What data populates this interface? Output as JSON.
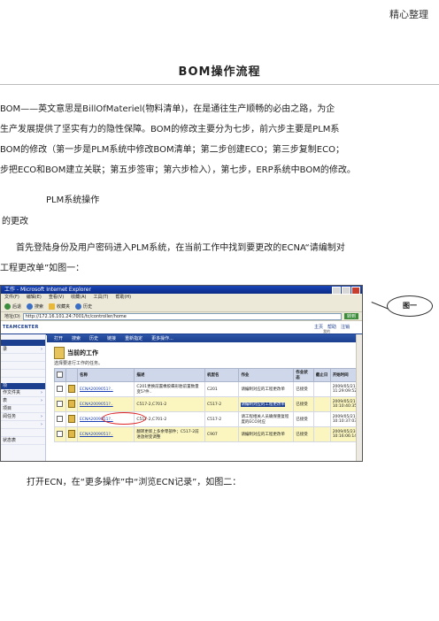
{
  "header": {
    "tag": "精心整理"
  },
  "doc": {
    "title": "BOM操作流程",
    "paragraphs": [
      "BOM——英文意思是BillOfMateriel(物料清单)，在是通往生产顺畅的必由之路，为企",
      "生产发展提供了坚实有力的隐性保障。BOM的修改主要分为七步，前六步主要是PLM系",
      "BOM的修改（第一步是PLM系统中修改BOM清单；第二步创建ECO；第三步复制ECO；",
      "步把ECO和BOM建立关联；第五步签审；第六步检入），第七步，ERP系统中BOM的修改。",
      "PLM系统操作",
      "的更改",
      "首先登陆身份及用户密码进入PLM系统，在当前工作中找到要更改的ECNA“请编制对",
      "工程更改单”如图一："
    ],
    "caption": "打开ECN，在“更多操作”中“浏览ECN记录”，如图二：",
    "callout": "图一"
  },
  "screenshot": {
    "window_title": "工作 - Microsoft Internet Explorer",
    "menu": [
      "文件(F)",
      "编辑(E)",
      "查看(V)",
      "收藏(A)",
      "工具(T)",
      "帮助(H)"
    ],
    "toolbar": [
      "后退",
      "搜索",
      "收藏夹",
      "历史"
    ],
    "address_label": "地址(D)",
    "address": "http://172.16.101.24:7001/tc/controller/home",
    "go": "转到",
    "brand": "TEAMCENTER",
    "user_links": [
      "主页",
      "帮助",
      "注销"
    ],
    "user_sub": "我的",
    "sidebar": {
      "heads": [
        "",
        "项"
      ],
      "items": [
        "录",
        "",
        "",
        "",
        "作文件夹",
        "表",
        "项目",
        "阅任务",
        "",
        "",
        "状态表"
      ]
    },
    "action_bar": [
      "打开",
      "搜索",
      "历史",
      "链接",
      "重新指定",
      "更多操作..."
    ],
    "worklist": {
      "title": "当前的工作",
      "subtitle": "选择要进行工作的任务。"
    },
    "table": {
      "headers": [
        "",
        "",
        "名称",
        "描述",
        "机型名",
        "作业",
        "作业状态",
        "截止日",
        "开始时间"
      ],
      "rows": [
        [
          "",
          "",
          "ECNA2009051?..",
          "C201更换前置橡胶蝶形胎前置数量变5?件..",
          "C201",
          "请编制对应的工程更改单",
          "已接受",
          "",
          "2009/05/21 11:29:09:529"
        ],
        [
          "",
          "",
          "ECNA2009051?..",
          "C517-2,C701-2",
          "C517-2",
          "请编制对应的工程更改单",
          "已接受",
          "",
          "2009/05/21 10:10:40:353"
        ],
        [
          "",
          "",
          "ECNA2009051?..",
          "C517-2,C701-2",
          "C517-2",
          "请工程相关人员确保重复程度的ECO对应",
          "已接受",
          "",
          "2009/05/21 10:10:37:038"
        ],
        [
          "",
          "",
          "ECNA2009051?..",
          "翻转更新上多余零部件；C517-2前进放射变调整",
          "C907",
          "请编制对应的工程更改单",
          "已接受",
          "",
          "2009/05/23 10:16:06:142"
        ]
      ]
    }
  }
}
